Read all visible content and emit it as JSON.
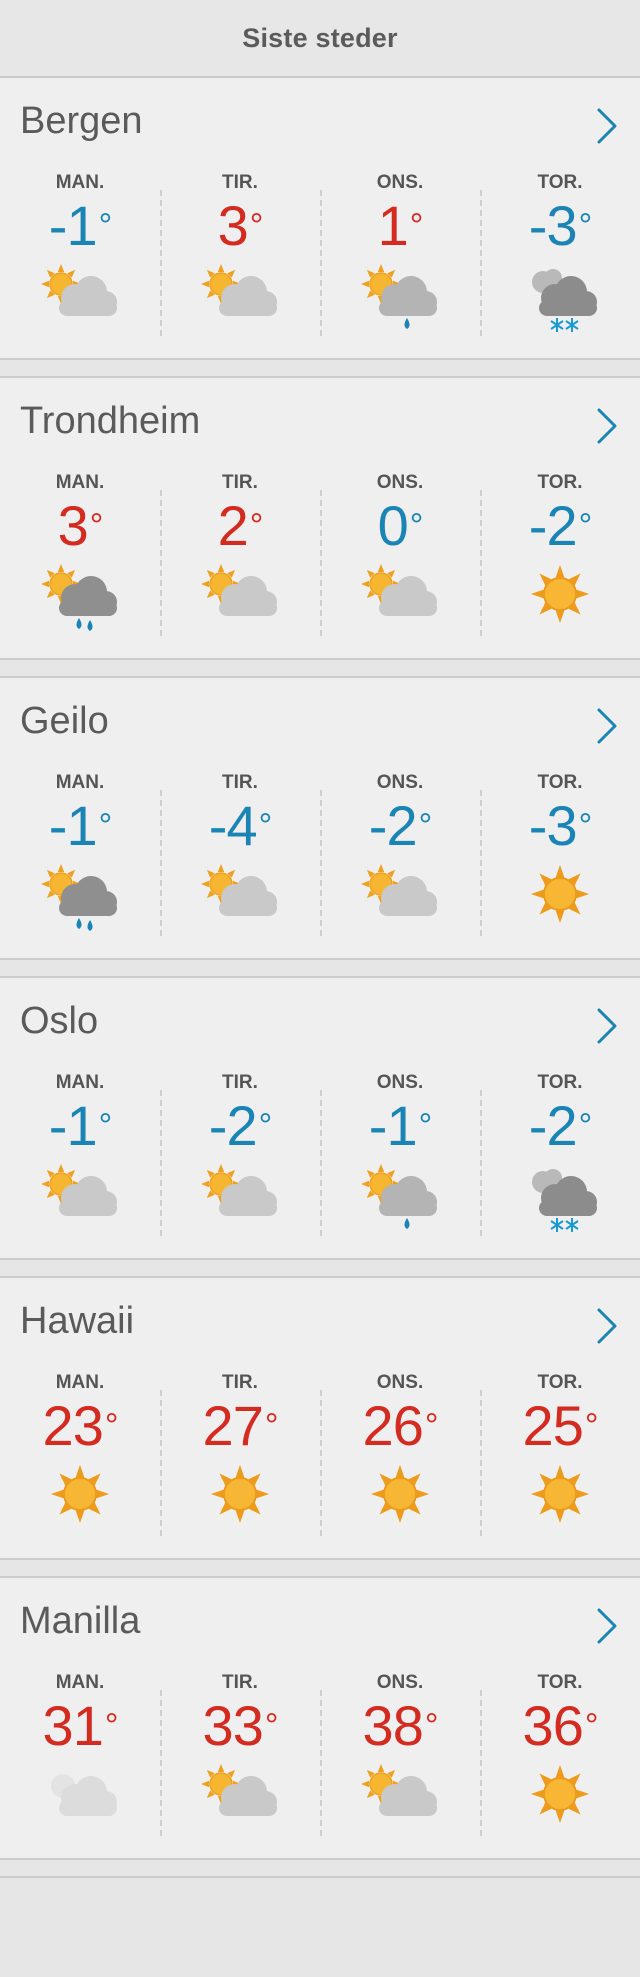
{
  "header": {
    "title": "Siste steder"
  },
  "colors": {
    "warm": "#d42b20",
    "cold": "#1a84b5",
    "chevron": "#1a84b5"
  },
  "cities": [
    {
      "name": "Bergen",
      "days": [
        {
          "label": "MAN.",
          "temp": "-1",
          "icon": "partly-cloudy-icon"
        },
        {
          "label": "TIR.",
          "temp": "3",
          "icon": "partly-cloudy-icon"
        },
        {
          "label": "ONS.",
          "temp": "1",
          "icon": "light-rain-icon"
        },
        {
          "label": "TOR.",
          "temp": "-3",
          "icon": "snow-icon"
        }
      ]
    },
    {
      "name": "Trondheim",
      "days": [
        {
          "label": "MAN.",
          "temp": "3",
          "icon": "rain-icon"
        },
        {
          "label": "TIR.",
          "temp": "2",
          "icon": "partly-cloudy-icon"
        },
        {
          "label": "ONS.",
          "temp": "0",
          "icon": "partly-cloudy-icon"
        },
        {
          "label": "TOR.",
          "temp": "-2",
          "icon": "sun-icon"
        }
      ]
    },
    {
      "name": "Geilo",
      "days": [
        {
          "label": "MAN.",
          "temp": "-1",
          "icon": "rain-icon"
        },
        {
          "label": "TIR.",
          "temp": "-4",
          "icon": "partly-cloudy-icon"
        },
        {
          "label": "ONS.",
          "temp": "-2",
          "icon": "partly-cloudy-icon"
        },
        {
          "label": "TOR.",
          "temp": "-3",
          "icon": "sun-icon"
        }
      ]
    },
    {
      "name": "Oslo",
      "days": [
        {
          "label": "MAN.",
          "temp": "-1",
          "icon": "partly-cloudy-icon"
        },
        {
          "label": "TIR.",
          "temp": "-2",
          "icon": "partly-cloudy-icon"
        },
        {
          "label": "ONS.",
          "temp": "-1",
          "icon": "light-rain-icon"
        },
        {
          "label": "TOR.",
          "temp": "-2",
          "icon": "snow-icon"
        }
      ]
    },
    {
      "name": "Hawaii",
      "days": [
        {
          "label": "MAN.",
          "temp": "23",
          "icon": "sun-icon"
        },
        {
          "label": "TIR.",
          "temp": "27",
          "icon": "sun-icon"
        },
        {
          "label": "ONS.",
          "temp": "26",
          "icon": "sun-icon"
        },
        {
          "label": "TOR.",
          "temp": "25",
          "icon": "sun-icon"
        }
      ]
    },
    {
      "name": "Manilla",
      "days": [
        {
          "label": "MAN.",
          "temp": "31",
          "icon": "fair-icon"
        },
        {
          "label": "TIR.",
          "temp": "33",
          "icon": "partly-cloudy-icon"
        },
        {
          "label": "ONS.",
          "temp": "38",
          "icon": "partly-cloudy-icon"
        },
        {
          "label": "TOR.",
          "temp": "36",
          "icon": "sun-icon"
        }
      ]
    }
  ]
}
